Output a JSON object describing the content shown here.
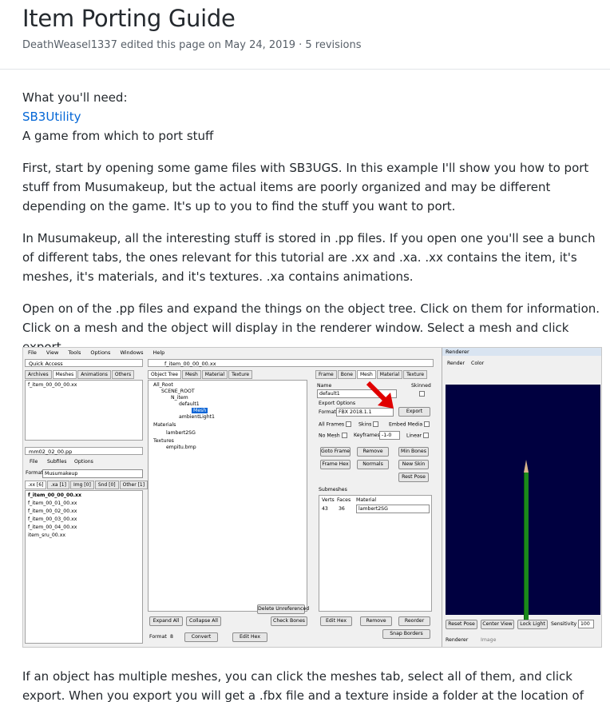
{
  "page": {
    "title": "Item Porting Guide",
    "meta": "DeathWeasel1337 edited this page on May 24, 2019 · 5 revisions",
    "needs_heading": "What you'll need:",
    "needs_link": "SB3Utility",
    "needs_item": "A game from which to port stuff",
    "para1": "First, start by opening some game files with SB3UGS. In this example I'll show you how to port stuff from Musumakeup, but the actual items are poorly organized and may be different depending on the game. It's up to you to find the stuff you want to port.",
    "para2": "In Musumakeup, all the interesting stuff is stored in .pp files. If you open one you'll see a bunch of different tabs, the ones relevant for this tutorial are .xx and .xa. .xx contains the item, it's meshes, it's materials, and it's textures. .xa contains animations.",
    "para3": "Open on of the .pp files and expand the things on the object tree. Click on them for information. Click on a mesh and the object will display in the renderer window. Select a mesh and click export.",
    "para4": "If an object has multiple meshes, you can click the meshes tab, select all of them, and click export. When you export you will get a .fbx file and a texture inside a folder at the location of the file you"
  },
  "app": {
    "menu": [
      "File",
      "View",
      "Tools",
      "Options",
      "Windows",
      "Help"
    ],
    "quick_access": {
      "title": "Quick Access",
      "tabs": [
        "Archives",
        "Meshes",
        "Animations",
        "Others"
      ],
      "items": [
        "f_item_00_00_00.xx"
      ]
    },
    "pp_window": {
      "title": "mm02_02_00.pp",
      "menu": [
        "File",
        "Subfiles",
        "Options"
      ],
      "format_label": "Format",
      "format_value": "Musumakeup",
      "tabs": [
        ".xx [6]",
        ".xa [1]",
        "Img [0]",
        "Snd [0]",
        "Other [1]"
      ],
      "files": [
        "f_item_00_00_00.xx",
        "f_item_00_01_00.xx",
        "f_item_00_02_00.xx",
        "f_item_00_03_00.xx",
        "f_item_00_04_00.xx",
        "item_sru_00.xx"
      ]
    },
    "xx_window": {
      "title": "f_item_00_00_00.xx",
      "tabs": [
        "Object Tree",
        "Mesh",
        "Material",
        "Texture"
      ],
      "tree": [
        "All_Root",
        "SCENE_ROOT",
        "N_item",
        "default1",
        "Mesh",
        "ambientLight1",
        "Materials",
        "lambert2SG",
        "Textures",
        "empitu.bmp"
      ],
      "btn_delete": "Delete Unreferenced",
      "btn_expand": "Expand All",
      "btn_collapse": "Collapse All",
      "btn_check": "Check Bones",
      "format_label": "Format",
      "format_value": "8",
      "btn_convert": "Convert",
      "btn_edithex": "Edit Hex"
    },
    "props": {
      "tabs": [
        "Frame",
        "Bone",
        "Mesh",
        "Material",
        "Texture"
      ],
      "name_label": "Name",
      "skinned_label": "Skinned",
      "name_value": "default1",
      "export_options": "Export Options",
      "format_label": "Format",
      "format_value": "FBX 2018.1.1",
      "btn_export": "Export",
      "all_frames": "All Frames",
      "skins": "Skins",
      "embed_media": "Embed Media",
      "no_mesh": "No Mesh",
      "keyframes": "Keyframes",
      "keyframes_value": "-1-0",
      "linear": "Linear",
      "btns_row1": [
        "Goto Frame",
        "Remove",
        "Min Bones"
      ],
      "btns_row2": [
        "Frame Hex",
        "Normals",
        "New Skin"
      ],
      "btn_rest": "Rest Pose",
      "submeshes": "Submeshes",
      "cols": [
        "Verts",
        "Faces",
        "Material"
      ],
      "row": [
        "43",
        "36",
        "lambert2SG"
      ],
      "btn_edithex": "Edit Hex",
      "btn_remove": "Remove",
      "btn_reorder": "Reorder",
      "btn_snap": "Snap Borders"
    },
    "renderer": {
      "title": "Renderer",
      "menu": [
        "Render",
        "Color"
      ],
      "btn_reset": "Reset Pose",
      "btn_center": "Center View",
      "btn_lock": "Lock Light",
      "sensitivity_label": "Sensitivity",
      "sensitivity_value": "100",
      "bottom_tabs": [
        "Renderer",
        "Image"
      ]
    },
    "colors": {
      "render_bg": "#000040",
      "mesh": "#1b8a1b",
      "arrow": "#e00000",
      "link": "#0366d6"
    }
  }
}
